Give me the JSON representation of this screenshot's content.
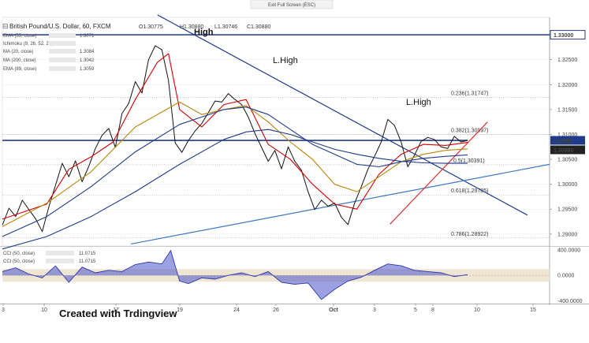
{
  "exit_fullscreen": "Exit Full Screen (ESC)",
  "legend": {
    "symbol": "British Pound/U.S. Dollar, 60, FXCM",
    "ohlc": [
      "O1.30775",
      "H1.30880",
      "L1.30746",
      "C1.30880"
    ],
    "indicators": [
      {
        "label": "EMA (55, close)",
        "value": "1.3071",
        "color": "#c0392b"
      },
      {
        "label": "Ichimoku (9, 26, 52, 26)",
        "value": "",
        "color": "#888888"
      },
      {
        "label": "MA (20, close)",
        "value": "1.3084",
        "color": "#d00000"
      },
      {
        "label": "MA (200, close)",
        "value": "1.3042",
        "color": "#1f3b8a"
      },
      {
        "label": "EMA (89, close)",
        "value": "1.3059",
        "color": "#1f3b8a"
      }
    ],
    "cci": [
      {
        "label": "CCI (50, close)",
        "value": "11.0715"
      },
      {
        "label": "CCI (50, close)",
        "value": "11.0715"
      }
    ]
  },
  "annotations": {
    "high": "High",
    "l_high_1": "L.High",
    "l_high_2": "L.High",
    "watermark": "Created with Trdingview"
  },
  "chart_data": {
    "type": "line",
    "title": "British Pound/U.S. Dollar, 60, FXCM",
    "xlabel": "",
    "ylabel": "",
    "x_tick_labels": [
      "3",
      "10",
      "17",
      "19",
      "24",
      "26",
      "Oct",
      "3",
      "5",
      "8",
      "10",
      "15"
    ],
    "y_ticks": [
      "1.29000",
      "1.29500",
      "1.30000",
      "1.30500",
      "1.31000",
      "1.31500",
      "1.32000",
      "1.32500",
      "1.33000"
    ],
    "ylim": [
      1.2876,
      1.3335
    ],
    "price_labels": {
      "upper": "1.33000",
      "current": "1.30881",
      "close": "1.30880"
    },
    "fib_levels": [
      {
        "label": "0.236(1.31747)",
        "value": 1.31747
      },
      {
        "label": "0.382(1.30997)",
        "value": 1.30997
      },
      {
        "label": "0.5(1.30391)",
        "value": 1.30391
      },
      {
        "label": "0.618(1.29785)",
        "value": 1.29785
      },
      {
        "label": "0.786(1.28922)",
        "value": 1.28922
      }
    ],
    "series": [
      {
        "name": "",
        "color": "#111111",
        "x": [
          0,
          3,
          6,
          9,
          12,
          15,
          18,
          21,
          24,
          27,
          30,
          33,
          36,
          39,
          42,
          45,
          48,
          51,
          54,
          57,
          60,
          63,
          66,
          69,
          72,
          75,
          78,
          81,
          84,
          87,
          90,
          93,
          96,
          99,
          102,
          105,
          108,
          111,
          114,
          117,
          120,
          123,
          126,
          129,
          132,
          135,
          138,
          141,
          144,
          147,
          150,
          153,
          156,
          159,
          162,
          165,
          168,
          171,
          174,
          177,
          180,
          183,
          186,
          189,
          192,
          195,
          198,
          201,
          204,
          207,
          210
        ],
        "values": [
          1.2918,
          1.2952,
          1.2935,
          1.2968,
          1.2949,
          1.2931,
          1.2905,
          1.2955,
          1.2998,
          1.3042,
          1.3015,
          1.3047,
          1.3005,
          1.3036,
          1.3072,
          1.3098,
          1.3112,
          1.3074,
          1.3142,
          1.3162,
          1.3206,
          1.3183,
          1.325,
          1.3278,
          1.327,
          1.3208,
          1.3083,
          1.3064,
          1.3088,
          1.3107,
          1.3122,
          1.3144,
          1.3167,
          1.3165,
          1.3182,
          1.317,
          1.316,
          1.3135,
          1.3102,
          1.3074,
          1.3046,
          1.3068,
          1.3031,
          1.3075,
          1.3046,
          1.3028,
          1.2985,
          1.2949,
          1.2968,
          1.2956,
          1.2962,
          1.2934,
          1.2919,
          1.2962,
          1.2995,
          1.303,
          1.3056,
          1.3085,
          1.313,
          1.3118,
          1.3085,
          1.3035,
          1.3058,
          1.3086,
          1.3094,
          1.309,
          1.3075,
          1.3072,
          1.3096,
          1.3085,
          1.3088
        ]
      },
      {
        "name": "",
        "color": "#d00000",
        "x": [
          0,
          10,
          20,
          30,
          40,
          50,
          60,
          70,
          75,
          80,
          90,
          100,
          110,
          120,
          130,
          140,
          150,
          160,
          170,
          180,
          190,
          200,
          210
        ],
        "values": [
          1.293,
          1.2945,
          1.296,
          1.303,
          1.3055,
          1.3085,
          1.317,
          1.3245,
          1.3262,
          1.315,
          1.3115,
          1.316,
          1.317,
          1.308,
          1.305,
          1.3,
          1.296,
          1.295,
          1.302,
          1.306,
          1.308,
          1.3078,
          1.3084
        ]
      },
      {
        "name": "",
        "color": "#b8860b",
        "x": [
          0,
          20,
          40,
          60,
          80,
          90,
          100,
          110,
          120,
          130,
          140,
          150,
          160,
          170,
          180,
          190,
          200,
          210
        ],
        "values": [
          1.2915,
          1.2962,
          1.3025,
          1.3115,
          1.3165,
          1.314,
          1.315,
          1.3158,
          1.3125,
          1.3085,
          1.305,
          1.3,
          1.2985,
          1.3015,
          1.3045,
          1.306,
          1.3068,
          1.3071
        ]
      },
      {
        "name": "",
        "color": "#1f3b8a",
        "x": [
          0,
          20,
          40,
          60,
          80,
          90,
          100,
          110,
          120,
          130,
          140,
          150,
          160,
          170,
          180,
          190,
          200,
          210
        ],
        "values": [
          1.2895,
          1.2935,
          1.2995,
          1.3065,
          1.312,
          1.3135,
          1.315,
          1.3155,
          1.314,
          1.311,
          1.308,
          1.306,
          1.304,
          1.3035,
          1.3045,
          1.3052,
          1.3056,
          1.3059
        ]
      },
      {
        "name": "",
        "color": "#1f3b8a",
        "x": [
          0,
          20,
          40,
          60,
          80,
          100,
          110,
          120,
          130,
          140,
          150,
          160,
          170,
          180,
          190,
          200,
          210
        ],
        "values": [
          1.287,
          1.2895,
          1.2935,
          1.2985,
          1.304,
          1.309,
          1.3105,
          1.311,
          1.31,
          1.3085,
          1.307,
          1.306,
          1.3052,
          1.3046,
          1.3043,
          1.3042,
          1.3042
        ]
      }
    ],
    "trendlines": [
      {
        "color": "#1f3b8a",
        "x": [
          70,
          237
        ],
        "values": [
          1.334,
          1.2938
        ]
      },
      {
        "color": "#1f3b8a",
        "x": [
          0,
          210
        ],
        "values": [
          1.3088,
          1.3088
        ]
      },
      {
        "color": "#1f3b8a",
        "x": [
          0,
          247
        ],
        "values": [
          1.33,
          1.33
        ]
      },
      {
        "color": "#3a78c3",
        "x": [
          58,
          247
        ],
        "values": [
          1.288,
          1.304
        ]
      },
      {
        "color": "#e03030",
        "x": [
          175,
          219
        ],
        "values": [
          1.292,
          1.3125
        ]
      }
    ],
    "cci": {
      "y_ticks": [
        "400.0000",
        "0.0000",
        "-400.0000"
      ],
      "ylim": [
        -420,
        450
      ],
      "band": [
        -100,
        100
      ],
      "x": [
        0,
        6,
        12,
        18,
        24,
        30,
        36,
        42,
        48,
        54,
        60,
        66,
        72,
        76,
        80,
        84,
        90,
        96,
        102,
        108,
        114,
        120,
        126,
        132,
        138,
        144,
        150,
        156,
        162,
        168,
        174,
        180,
        186,
        192,
        198,
        204,
        210
      ],
      "values": [
        60,
        120,
        20,
        -40,
        150,
        -110,
        130,
        40,
        80,
        60,
        170,
        210,
        180,
        390,
        -90,
        -130,
        -40,
        -60,
        0,
        40,
        -20,
        60,
        -110,
        -140,
        -120,
        -380,
        -220,
        -90,
        -30,
        80,
        180,
        150,
        80,
        60,
        40,
        -20,
        11
      ]
    }
  }
}
